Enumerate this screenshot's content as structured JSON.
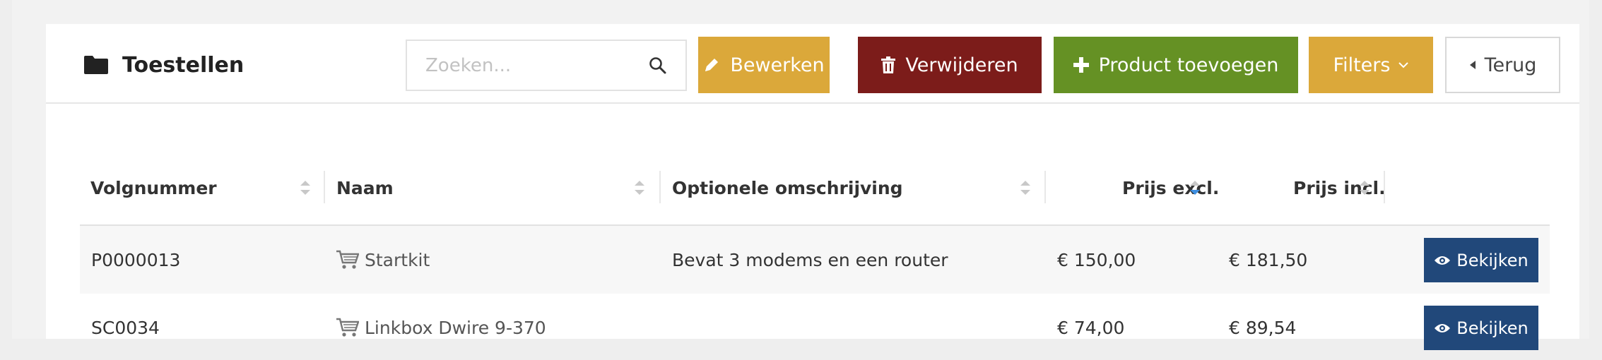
{
  "header": {
    "title": "Toestellen",
    "search_placeholder": "Zoeken...",
    "buttons": {
      "edit": "Bewerken",
      "delete": "Verwijderen",
      "add": "Product toevoegen",
      "filters": "Filters",
      "back": "Terug"
    }
  },
  "table": {
    "columns": [
      "Volgnummer",
      "Naam",
      "Optionele omschrijving",
      "Prijs excl.",
      "Prijs incl."
    ],
    "rows": [
      {
        "volgnummer": "P0000013",
        "naam": "Startkit",
        "omschrijving": "Bevat 3 modems en een router",
        "prijs_excl": "€ 150,00",
        "prijs_incl": "€ 181,50",
        "action": "Bekijken"
      },
      {
        "volgnummer": "SC0034",
        "naam": "Linkbox Dwire 9-370",
        "omschrijving": "",
        "prijs_excl": "€ 74,00",
        "prijs_incl": "€ 89,54",
        "action": "Bekijken"
      }
    ]
  },
  "colors": {
    "edit": "#dba83a",
    "delete": "#7c1c1a",
    "add": "#659124",
    "filters": "#dba83a",
    "view": "#21487a",
    "active_sort": "#3d8ee0"
  }
}
